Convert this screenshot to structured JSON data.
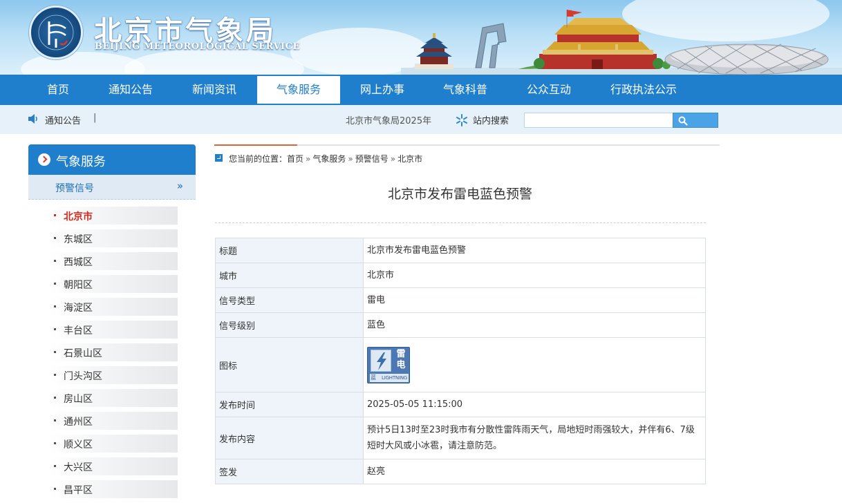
{
  "header": {
    "site_title": "北京市气象局",
    "site_subtitle": "BEIJING METEOROLOGICAL SERVICE"
  },
  "nav": {
    "items": [
      {
        "label": "首页"
      },
      {
        "label": "通知公告"
      },
      {
        "label": "新闻资讯"
      },
      {
        "label": "气象服务"
      },
      {
        "label": "网上办事"
      },
      {
        "label": "气象科普"
      },
      {
        "label": "公众互动"
      },
      {
        "label": "行政执法公示"
      }
    ],
    "active": "气象服务"
  },
  "notice_bar": {
    "label": "通知公告",
    "separator": "|",
    "marquee_text": "北京市气象局2025年",
    "search_label": "站内搜索",
    "search_value": ""
  },
  "sidebar": {
    "title": "气象服务",
    "section": "预警信号",
    "section_arrow": "»",
    "items": [
      {
        "label": "北京市"
      },
      {
        "label": "东城区"
      },
      {
        "label": "西城区"
      },
      {
        "label": "朝阳区"
      },
      {
        "label": "海淀区"
      },
      {
        "label": "丰台区"
      },
      {
        "label": "石景山区"
      },
      {
        "label": "门头沟区"
      },
      {
        "label": "房山区"
      },
      {
        "label": "通州区"
      },
      {
        "label": "顺义区"
      },
      {
        "label": "大兴区"
      },
      {
        "label": "昌平区"
      }
    ],
    "active": "北京市"
  },
  "breadcrumb": {
    "prefix": "您当前的位置：",
    "items": [
      "首页",
      "气象服务",
      "预警信号",
      "北京市"
    ],
    "separator": "»"
  },
  "article": {
    "title": "北京市发布雷电蓝色预警",
    "rows": {
      "title": {
        "key": "标题",
        "value": "北京市发布雷电蓝色预警"
      },
      "city": {
        "key": "城市",
        "value": "北京市"
      },
      "signal_type": {
        "key": "信号类型",
        "value": "雷电"
      },
      "signal_level": {
        "key": "信号级别",
        "value": "蓝色"
      },
      "icon": {
        "key": "图标",
        "icon_name": "lightning-blue-warning-icon",
        "icon_text_top": "雷",
        "icon_text_mid": "电",
        "icon_text_level": "蓝",
        "icon_text_en": "LIGHTNING"
      },
      "publish_time": {
        "key": "发布时间",
        "value": "2025-05-05 11:15:00"
      },
      "content": {
        "key": "发布内容",
        "value": "预计5日13时至23时我市有分散性雷阵雨天气，局地短时雨强较大，并伴有6、7级短时大风或小冰雹，请注意防范。"
      },
      "signer": {
        "key": "签发",
        "value": "赵亮"
      }
    }
  },
  "colors": {
    "nav_blue": "#1f7fcd",
    "notice_bg": "#e6f1f9",
    "active_red": "#d42a1e",
    "warning_blue": "#4c79b4"
  }
}
